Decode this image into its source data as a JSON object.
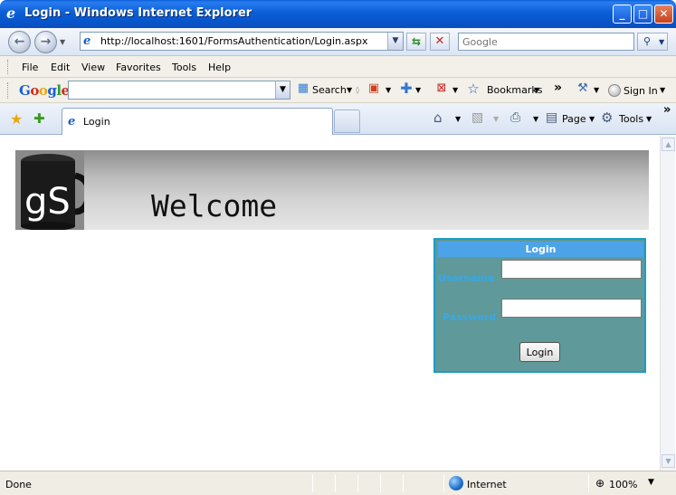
{
  "window": {
    "title": "Login - Windows Internet Explorer",
    "controls": {
      "minimize": "_",
      "maximize": "□",
      "close": "✕"
    }
  },
  "address_bar": {
    "url": "http://localhost:1601/FormsAuthentication/Login.aspx",
    "search_placeholder": "Google"
  },
  "menu": {
    "items": [
      "File",
      "Edit",
      "View",
      "Favorites",
      "Tools",
      "Help"
    ]
  },
  "google_toolbar": {
    "search_label": "Search",
    "bookmarks_label": "Bookmarks",
    "more_label": "»",
    "sign_in_label": "Sign In"
  },
  "tabs": [
    {
      "label": "Login"
    }
  ],
  "command_bar": {
    "page_label": "Page",
    "tools_label": "Tools",
    "more_label": "»"
  },
  "page": {
    "banner": {
      "heading": "Welcome",
      "logo_text": "gS"
    },
    "login": {
      "title": "Login",
      "username_label": "Username",
      "password_label": "Password",
      "username_value": "",
      "password_value": "",
      "submit_label": "Login"
    }
  },
  "status_bar": {
    "status": "Done",
    "zone": "Internet",
    "zoom": "100%"
  },
  "colors": {
    "titlebar": "#0b5ed6",
    "login_panel": "#5f9999",
    "login_header": "#4da3e8",
    "login_label": "#37a8e8"
  }
}
